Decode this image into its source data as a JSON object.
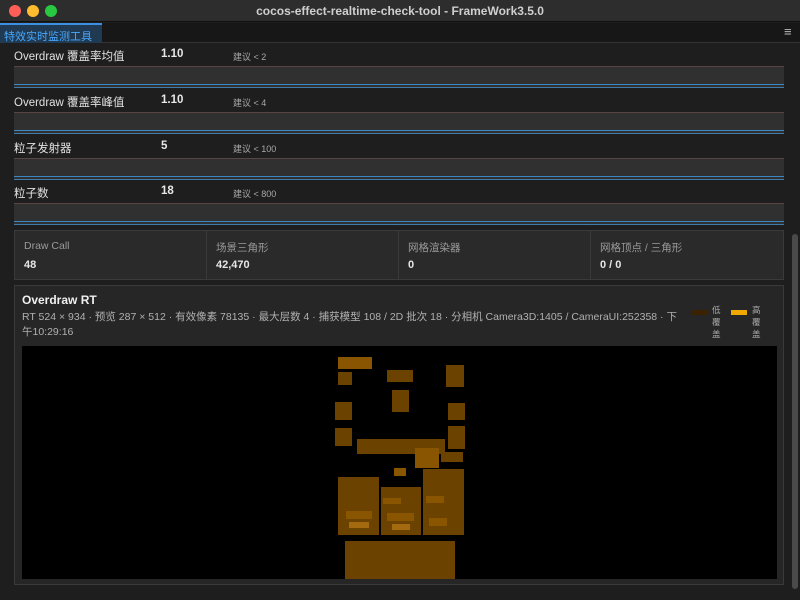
{
  "window": {
    "title": "cocos-effect-realtime-check-tool - FrameWork3.5.0"
  },
  "tabs": [
    {
      "label": "特效实时监测工具"
    }
  ],
  "metrics": [
    {
      "label": "Overdraw 覆盖率均值",
      "value": "1.10",
      "hint": "建议 < 2"
    },
    {
      "label": "Overdraw 覆盖率峰值",
      "value": "1.10",
      "hint": "建议 < 4"
    },
    {
      "label": "粒子发射器",
      "value": "5",
      "hint": "建议 < 100"
    },
    {
      "label": "粒子数",
      "value": "18",
      "hint": "建议 < 800"
    }
  ],
  "stats": [
    {
      "label": "Draw Call",
      "value": "48"
    },
    {
      "label": "场景三角形",
      "value": "42,470"
    },
    {
      "label": "网格渲染器",
      "value": "0"
    },
    {
      "label": "网格顶点 / 三角形",
      "value": "0 / 0"
    }
  ],
  "overdraw": {
    "title": "Overdraw RT",
    "info": "RT 524 × 934 · 预览 287 × 512 · 有效像素 78135 · 最大层数 4 · 捕获模型 108 / 2D 批次 18 · 分相机 Camera3D:1405 / CameraUI:252358 · 下午10:29:16",
    "legend_low": "低覆盖",
    "legend_high": "高覆盖",
    "colors": {
      "low": "#3a2200",
      "high": "#f0a800"
    }
  }
}
